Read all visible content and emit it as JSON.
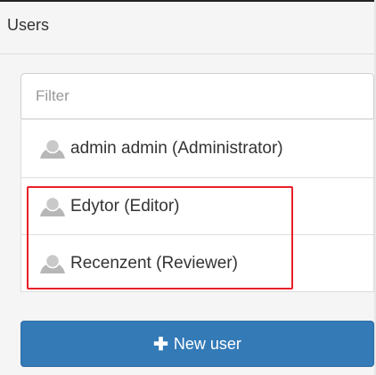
{
  "panel": {
    "title": "Users"
  },
  "filter": {
    "placeholder": "Filter",
    "value": ""
  },
  "users": [
    {
      "label": "admin admin (Administrator)",
      "icon": "user-avatar-icon"
    },
    {
      "label": "Edytor (Editor)",
      "icon": "user-avatar-icon"
    },
    {
      "label": "Recenzent (Reviewer)",
      "icon": "user-avatar-icon"
    }
  ],
  "buttons": {
    "new_user_label": "New user",
    "new_user_icon": "plus-icon"
  },
  "colors": {
    "primary": "#337ab7",
    "highlight": "#e8202a",
    "panel_bg": "#f5f5f5",
    "avatar": "#b7b7b7"
  }
}
